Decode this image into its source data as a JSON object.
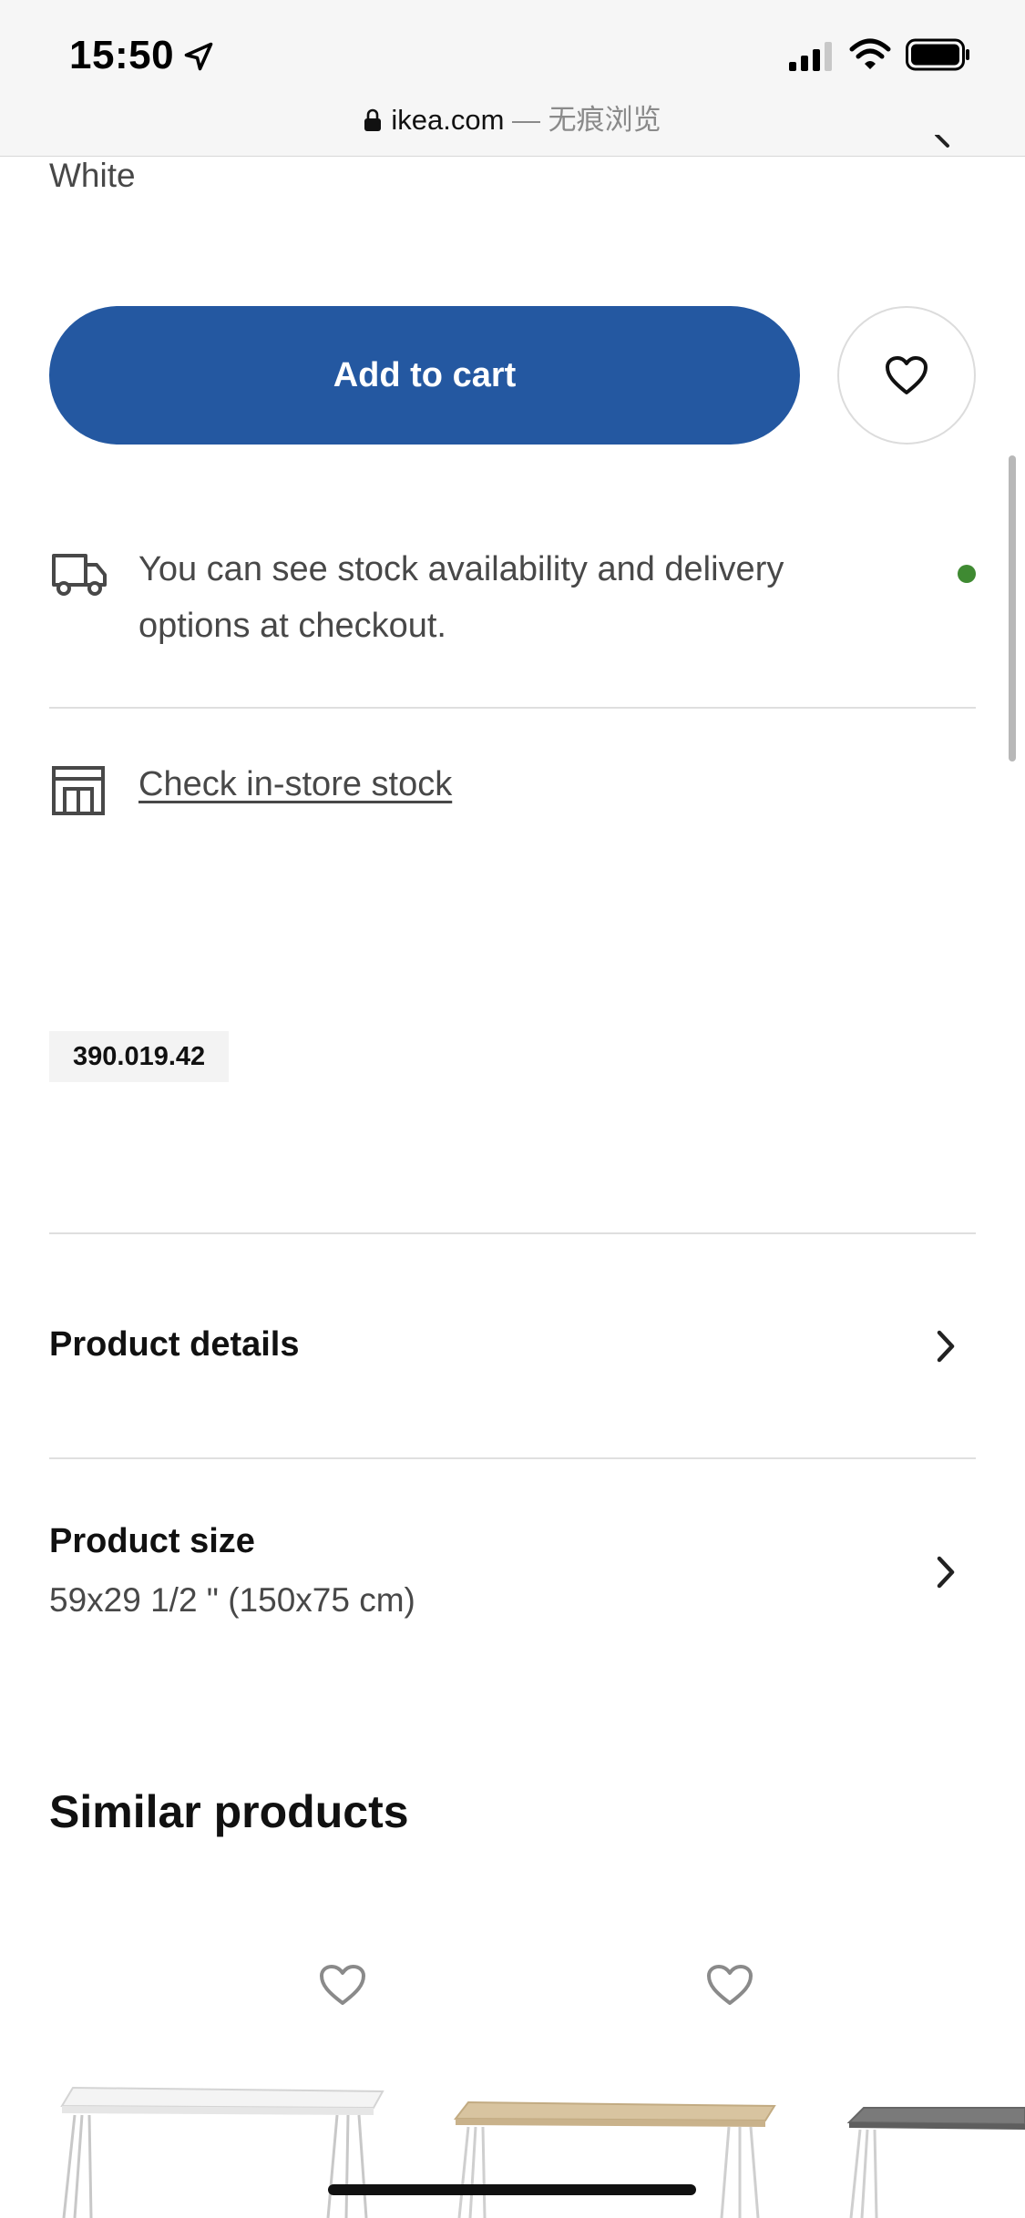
{
  "status_bar": {
    "time": "15:50",
    "url": "ikea.com",
    "mode": "— 无痕浏览"
  },
  "product": {
    "color_value": "White",
    "add_to_cart_label": "Add to cart",
    "stock_message": "You can see stock availability and delivery options at checkout.",
    "check_store_label": "Check in-store stock",
    "article_number": "390.019.42",
    "details_label": "Product details",
    "size_label": "Product size",
    "size_value": "59x29 1/2 \" (150x75 cm)"
  },
  "similar": {
    "title": "Similar products"
  },
  "colors": {
    "primary_blue": "#2458a1",
    "stock_green": "#3f8a32",
    "text_gray": "#484848"
  }
}
